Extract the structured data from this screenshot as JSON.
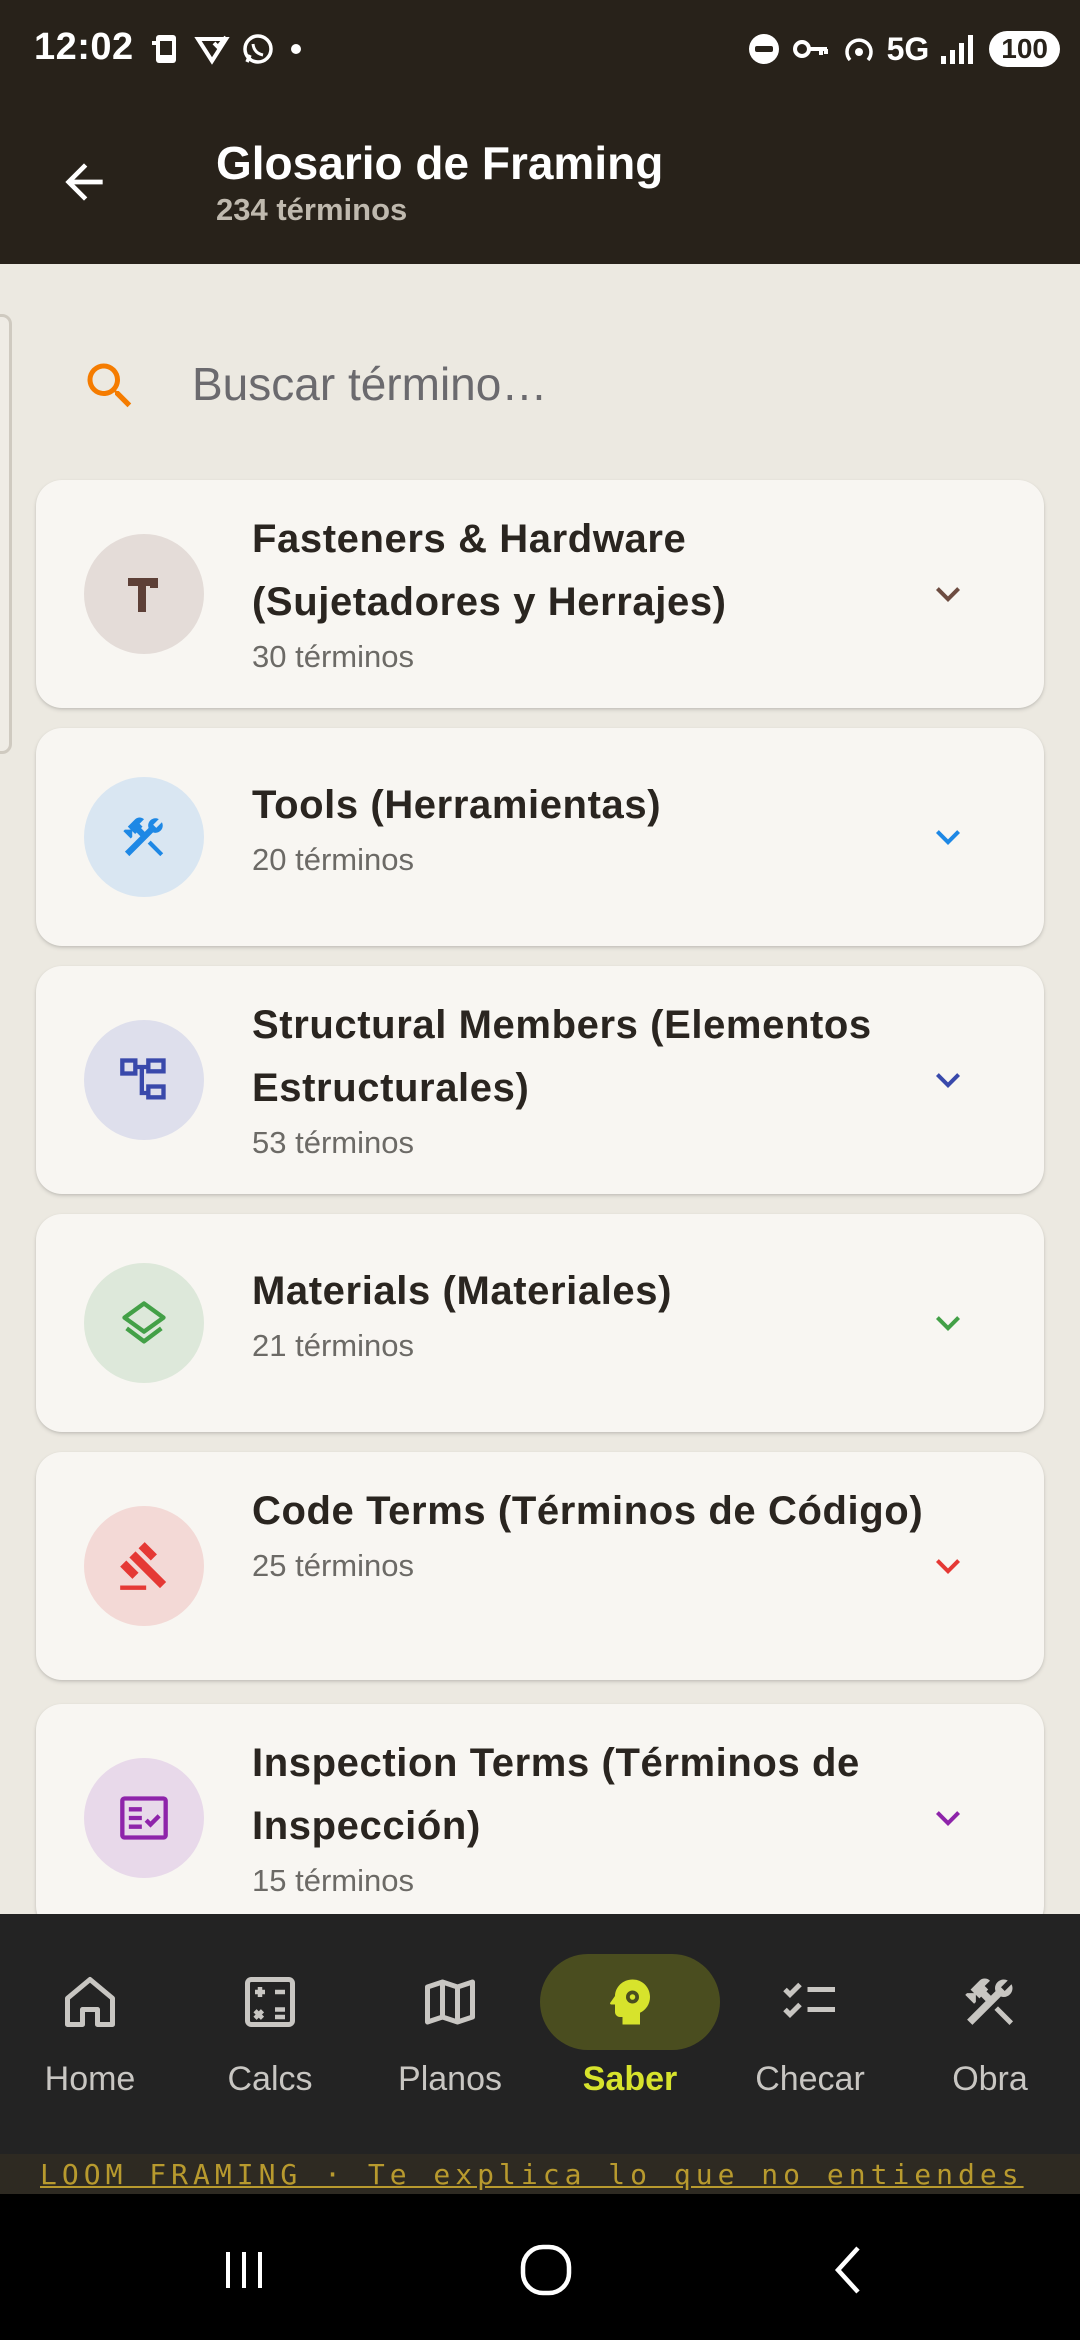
{
  "status_bar": {
    "time": "12:02",
    "network": "5G",
    "battery": "100"
  },
  "header": {
    "title": "Glosario de Framing",
    "subtitle": "234 términos"
  },
  "search": {
    "placeholder": "Buscar término…",
    "value": ""
  },
  "categories": [
    {
      "title": "Fasteners & Hardware (Sujetadores y Herrajes)",
      "count": "30 términos",
      "icon": "hammer-icon",
      "accent": "#6D4C41",
      "bg": "#E4DCD8"
    },
    {
      "title": "Tools (Herramientas)",
      "count": "20 términos",
      "icon": "tools-icon",
      "accent": "#1E88E5",
      "bg": "#D9E6F2"
    },
    {
      "title": "Structural Members (Elementos Estructurales)",
      "count": "53 términos",
      "icon": "hierarchy-icon",
      "accent": "#3949AB",
      "bg": "#DEDFEC"
    },
    {
      "title": "Materials (Materiales)",
      "count": "21 términos",
      "icon": "layers-icon",
      "accent": "#43A047",
      "bg": "#DDE8DA"
    },
    {
      "title": "Code Terms (Términos de Código)",
      "count": "25 términos",
      "icon": "gavel-icon",
      "accent": "#E53935",
      "bg": "#F3D9D6"
    },
    {
      "title": "Inspection Terms (Términos de Inspección)",
      "count": "15 términos",
      "icon": "checklist-icon",
      "accent": "#8E24AA",
      "bg": "#E8D9EA"
    }
  ],
  "bottom_nav": {
    "items": [
      {
        "label": "Home",
        "icon": "home-icon"
      },
      {
        "label": "Calcs",
        "icon": "calculator-icon"
      },
      {
        "label": "Planos",
        "icon": "map-icon"
      },
      {
        "label": "Saber",
        "icon": "brain-icon",
        "active": true
      },
      {
        "label": "Checar",
        "icon": "checklist-icon"
      },
      {
        "label": "Obra",
        "icon": "tools-icon"
      }
    ]
  },
  "tagline": "LOOM FRAMING  ·  Te explica lo que no entiendes",
  "colors": {
    "header_bg": "#28221A",
    "page_bg": "#ECE9E1",
    "search_icon": "#F57C00",
    "nav_active": "#D7E32C"
  }
}
